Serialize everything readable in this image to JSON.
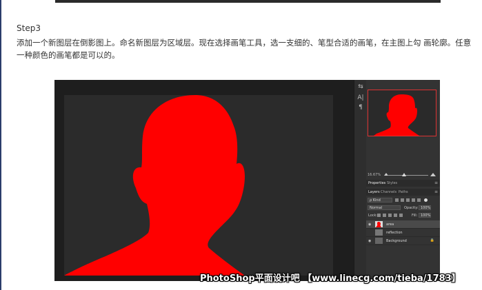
{
  "article": {
    "step_title": "Step3",
    "step_text": "添加一个新图层在倒影图上。命名新图层为区域层。现在选择画笔工具，选一支细的、笔型合适的画笔，在主图上勾 画轮廓。任意一种颜色的画笔都是可以的。"
  },
  "colors": {
    "mask_red": "#ff0000",
    "canvas_bg": "#2b2b2b",
    "panel_bg": "#333333",
    "rule_blue": "#2b3d6b"
  },
  "photoshop": {
    "zoom": "16.67%",
    "tabs_top": [
      "Properties",
      "Styles"
    ],
    "tabs_layers": [
      "Layers",
      "Channels",
      "Paths"
    ],
    "filter_kind": "ρ Kind",
    "blend_mode": "Normal",
    "opacity_label": "Opacity:",
    "opacity_value": "100%",
    "lock_label": "Lock:",
    "fill_label": "Fill:",
    "fill_value": "100%",
    "layers": [
      {
        "name": "area",
        "active": true
      },
      {
        "name": "reflection",
        "active": false
      },
      {
        "name": "Background",
        "active": false
      }
    ]
  },
  "watermark": "PhotoShop平面设计吧 【www.linecg.com/tieba/1783】"
}
